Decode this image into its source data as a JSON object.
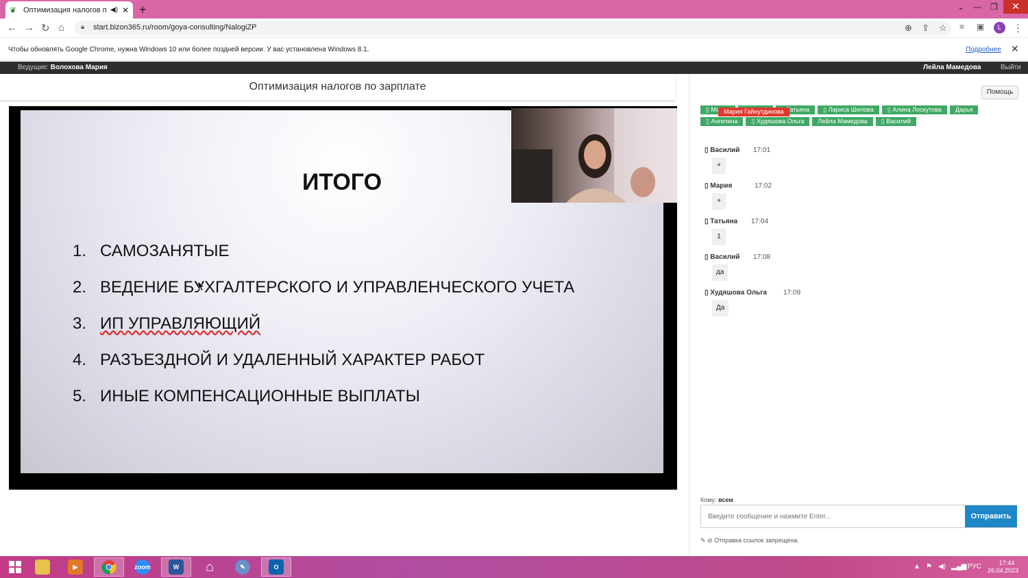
{
  "browser": {
    "tab_title": "Оптимизация налогов по з",
    "url": "start.bizon365.ru/room/goya-consulting/NalogiZP",
    "profile_initial": "L"
  },
  "infobar": {
    "text": "Чтобы обновлять Google Chrome, нужна Windows 10 или более поздней версии. У вас установлена Windows 8.1.",
    "link": "Подробнее"
  },
  "room": {
    "host_label": "Ведущие:",
    "host_name": "Волохова Мария",
    "current_user": "Лейла Мамедова",
    "logout": "Выйти",
    "title": "Оптимизация налогов по зарплате"
  },
  "slide": {
    "title": "ИТОГО",
    "items": [
      {
        "num": "1.",
        "text": "САМОЗАНЯТЫЕ"
      },
      {
        "num": "2.",
        "text": "ВЕДЕНИЕ БУХГАЛТЕРСКОГО И УПРАВЛЕНЧЕСКОГО УЧЕТА"
      },
      {
        "num": "3.",
        "text": "ИП УПРАВЛЯЮЩИЙ"
      },
      {
        "num": "4.",
        "text": "РАЗЪЕЗДНОЙ И УДАЛЕННЫЙ ХАРАКТЕР РАБОТ"
      },
      {
        "num": "5.",
        "text": "ИНЫЕ КОМПЕНСАЦИОННЫЕ ВЫПЛАТЫ"
      }
    ]
  },
  "chat": {
    "help": "Помощь",
    "users": [
      "Мария Гайнутдинова",
      "Мария",
      "Наталья",
      "Татьяна",
      "Лариса Шилова",
      "Алина Лоскутова",
      "Дарья",
      "Ангелина",
      "Худяшова Ольга",
      "Лейла Мамедова",
      "Василий"
    ],
    "messages": [
      {
        "name": "Василий",
        "time": "17:01",
        "text": "+"
      },
      {
        "name": "Мария",
        "time": "17:02",
        "text": "+"
      },
      {
        "name": "Татьяна",
        "time": "17:04",
        "text": "1"
      },
      {
        "name": "Василий",
        "time": "17:08",
        "text": "да"
      },
      {
        "name": "Худяшова Ольга",
        "time": "17:09",
        "text": "Да"
      }
    ],
    "to_label": "Кому:",
    "to_value": "всем",
    "input_placeholder": "Введите сообщение и нажмите Enter...",
    "send": "Отправить",
    "link_note": "Отправка ссылок запрещена."
  },
  "taskbar": {
    "lang": "РУС",
    "time": "17:44",
    "date": "26.04.2023"
  }
}
